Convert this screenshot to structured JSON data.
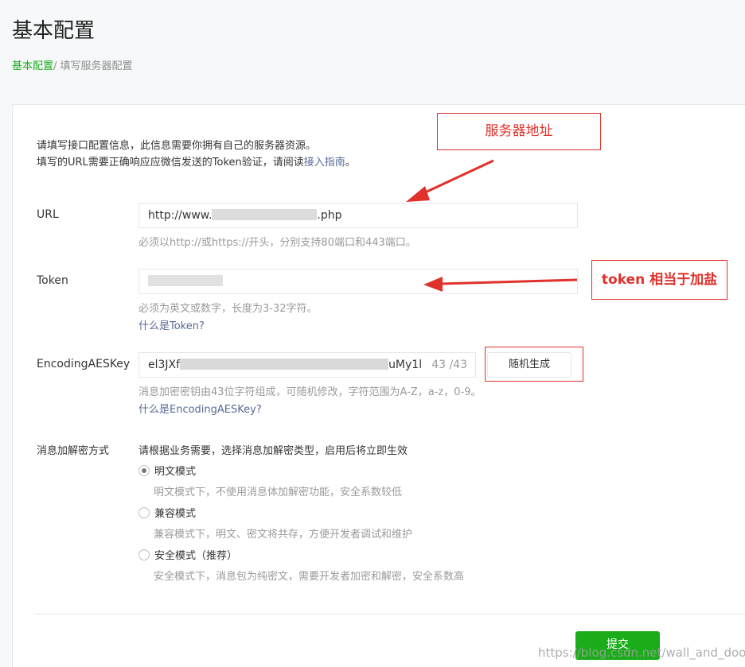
{
  "page": {
    "title": "基本配置",
    "breadcrumb": {
      "link": "基本配置",
      "separator": "/ ",
      "current": "填写服务器配置"
    }
  },
  "intro": {
    "line1": "请填写接口配置信息，此信息需要你拥有自己的服务器资源。",
    "line2_prefix": "填写的URL需要正确响应应微信发送的Token验证，请阅读",
    "line2_link": "接入指南",
    "line2_suffix": "。"
  },
  "url": {
    "label": "URL",
    "value_prefix": "http://www.",
    "value_suffix": ".php",
    "tip": "必须以http://或https://开头，分别支持80端口和443端口。"
  },
  "token": {
    "label": "Token",
    "tip": "必须为英文或数字，长度为3-32字符。",
    "help_link": "什么是Token?"
  },
  "aes": {
    "label": "EncodingAESKey",
    "value_prefix": "el3JXf",
    "value_suffix": "uMy1l",
    "counter": "43 /43",
    "random_button": "随机生成",
    "tip": "消息加密密钥由43位字符组成，可随机修改，字符范围为A-Z，a-z，0-9。",
    "help_link": "什么是EncodingAESKey?"
  },
  "encryption": {
    "label": "消息加解密方式",
    "hint": "请根据业务需要，选择消息加解密类型，启用后将立即生效",
    "options": [
      {
        "label": "明文模式",
        "desc": "明文模式下，不使用消息体加解密功能，安全系数较低",
        "checked": true
      },
      {
        "label": "兼容模式",
        "desc": "兼容模式下，明文、密文将共存，方便开发者调试和维护",
        "checked": false
      },
      {
        "label": "安全模式（推荐）",
        "desc": "安全模式下，消息包为纯密文，需要开发者加密和解密，安全系数高",
        "checked": false
      }
    ]
  },
  "submit_label": "提交",
  "annotations": {
    "server_address": "服务器地址",
    "token_note": "token 相当于加盐"
  },
  "watermark": "https://blog.csdn.net/wall_and_door",
  "colors": {
    "accent": "#1aad19",
    "link": "#576b95",
    "annotation": "#e0312b"
  }
}
